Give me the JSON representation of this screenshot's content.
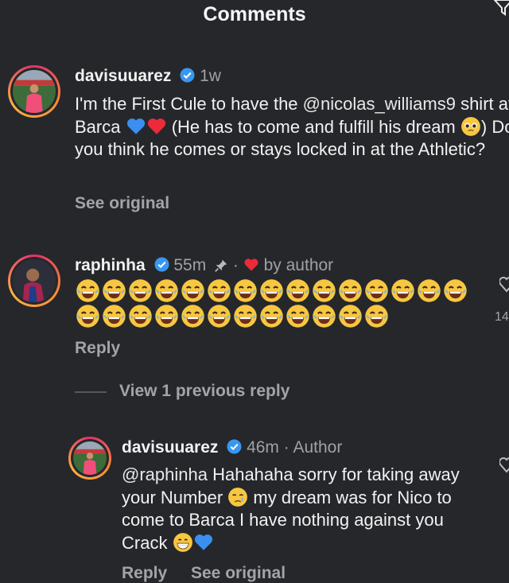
{
  "header": {
    "title": "Comments"
  },
  "comments": [
    {
      "username": "davisuuarez",
      "time": "1w",
      "text_parts": [
        "I'm the First Cule to have the ",
        "@nicolas_williams9",
        " shirt at Barca ",
        " (He has to come and fulfill his dream ",
        ") Do you think he comes or stays locked in at the Athletic?"
      ],
      "action": "See original"
    },
    {
      "username": "raphinha",
      "time": "55m",
      "byline": "by author",
      "laughs_row1": 15,
      "laughs_row2": 12,
      "action": "Reply",
      "like_count": "14",
      "view_previous": "View 1 previous reply"
    },
    {
      "username": "davisuuarez",
      "time": "46m",
      "author_label": "Author",
      "text_parts": [
        "@raphinha",
        " Hahahaha sorry for taking away your Number ",
        " my dream was for Nico to come to Barca I have nothing against you Crack "
      ],
      "actions": [
        "Reply",
        "See original"
      ]
    }
  ],
  "icons": {
    "verified": "verified-badge-icon",
    "pin": "pin-icon",
    "heart": "red-heart-icon",
    "like": "heart-outline-icon",
    "filter": "filter-icon"
  },
  "colors": {
    "background": "#26272b",
    "verified": "#3897f0",
    "heart": "#ed2a3a",
    "blue_heart": "#3a8ff0"
  }
}
